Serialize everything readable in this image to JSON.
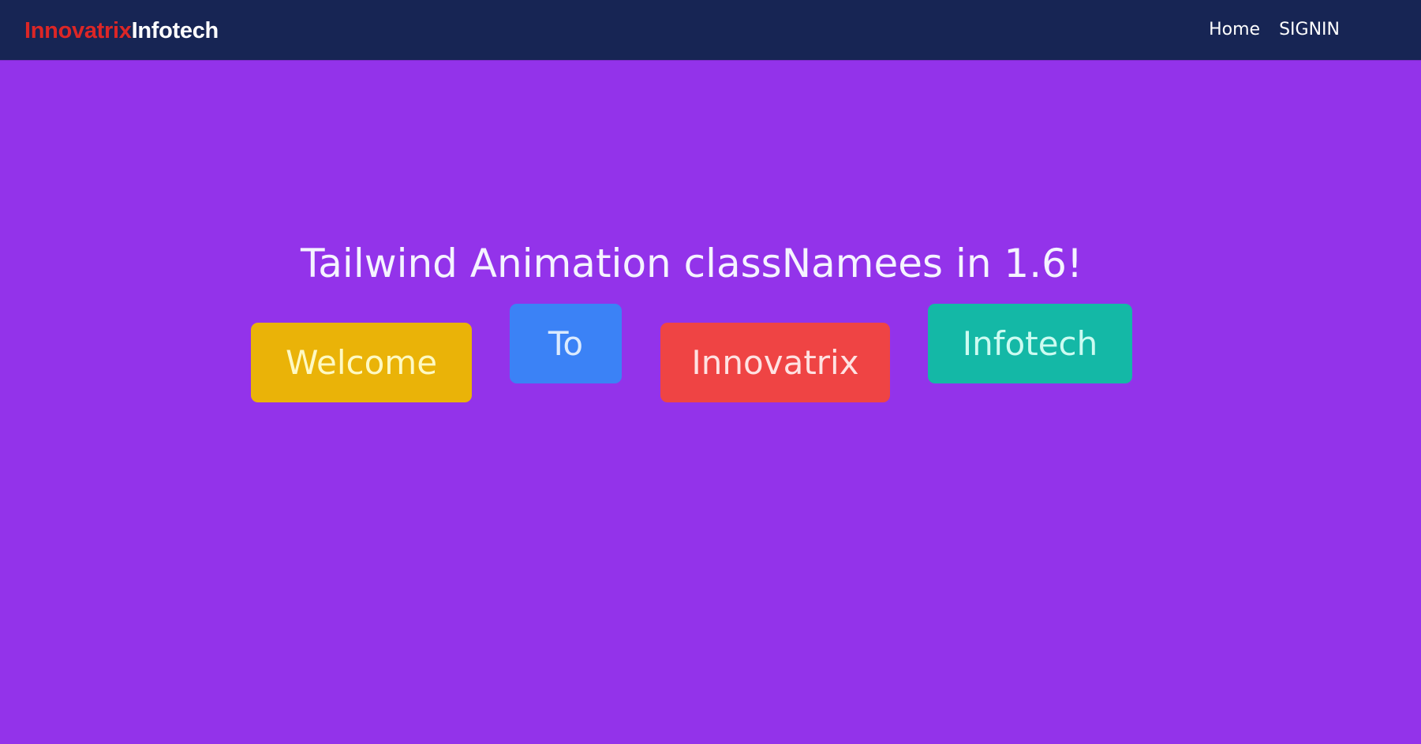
{
  "navbar": {
    "logo": {
      "part1": "Innovatrix",
      "part2": "Infotech"
    },
    "links": [
      {
        "label": "Home"
      },
      {
        "label": "SIGNIN"
      }
    ]
  },
  "hero": {
    "headline": "Tailwind Animation classNamees in 1.6!",
    "tiles": [
      {
        "label": "Welcome",
        "color": "#eab308"
      },
      {
        "label": "To",
        "color": "#3b82f6"
      },
      {
        "label": "Innovatrix",
        "color": "#ef4444"
      },
      {
        "label": "Infotech",
        "color": "#14b8a6"
      }
    ]
  },
  "colors": {
    "background": "#9333ea",
    "navbar": "#172554",
    "logo_accent": "#dc2626"
  }
}
